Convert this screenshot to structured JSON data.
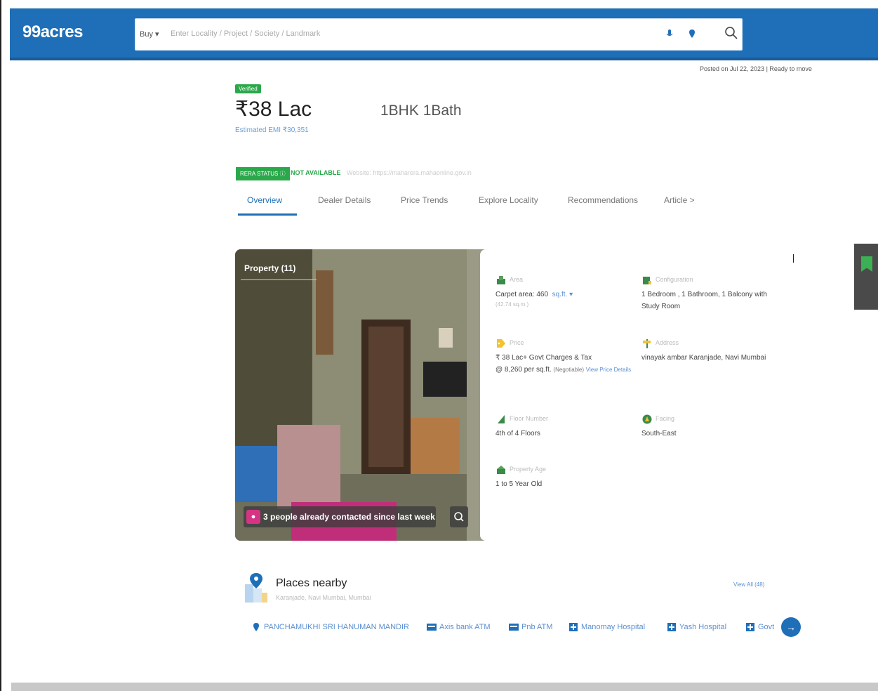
{
  "header": {
    "logo": "99acres",
    "search_type": "Buy",
    "search_placeholder": "Enter Locality / Project / Society / Landmark"
  },
  "listing": {
    "breadcrumb": "",
    "posted": "Posted on Jul 22, 2023  |  Ready to move",
    "verified_badge": "Verified",
    "price": "₹38 Lac",
    "price_sub": "",
    "emi": "Estimated EMI ₹30,351",
    "config": "1BHK 1Bath",
    "config_sub1": "",
    "config_sub2": "",
    "rera_status": "RERA STATUS",
    "rera_value": "NOT AVAILABLE",
    "rera_note": "Website: https://maharera.mahaonline.gov.in"
  },
  "tabs": [
    {
      "label": "Overview"
    },
    {
      "label": "Dealer Details"
    },
    {
      "label": "Price Trends"
    },
    {
      "label": "Explore Locality"
    },
    {
      "label": "Recommendations"
    },
    {
      "label": "Article >"
    }
  ],
  "gallery": {
    "label": "Property (11)",
    "contacted": "3 people already contacted since last week"
  },
  "details": {
    "area": {
      "label": "Area",
      "value": "Carpet area: 460",
      "unit": "sq.ft.",
      "sub": "(42.74 sq.m.)"
    },
    "config": {
      "label": "Configuration",
      "value": "1 Bedroom , 1 Bathroom, 1 Balcony with Study Room"
    },
    "price": {
      "label": "Price",
      "value": "₹ 38 Lac+ Govt Charges & Tax",
      "rate": "@ 8,260 per sq.ft.",
      "negotiable": "(Negotiable)",
      "link": "View Price Details"
    },
    "address": {
      "label": "Address",
      "value": "vinayak ambar Karanjade, Navi Mumbai"
    },
    "floor": {
      "label": "Floor Number",
      "value": "4th  of 4 Floors"
    },
    "facing": {
      "label": "Facing",
      "value": "South-East"
    },
    "age": {
      "label": "Property Age",
      "value": "1 to 5 Year Old"
    }
  },
  "nearby": {
    "title": "Places nearby",
    "sub": "Karanjade, Navi Mumbai, Mumbai",
    "view_all": "View All (48)",
    "places": [
      {
        "name": "PANCHAMUKHI SRI HANUMAN MANDIR",
        "icon": "temple-pin-icon"
      },
      {
        "name": "Axis bank ATM",
        "icon": "atm-icon"
      },
      {
        "name": "Pnb ATM",
        "icon": "atm-icon"
      },
      {
        "name": "Manomay Hospital",
        "icon": "hospital-icon"
      },
      {
        "name": "Yash Hospital",
        "icon": "hospital-icon"
      },
      {
        "name": "Govt",
        "icon": "hospital-icon"
      }
    ]
  },
  "colors": {
    "brand": "#1f6fb8",
    "green": "#2aa84a",
    "link": "#5b8fd1"
  }
}
